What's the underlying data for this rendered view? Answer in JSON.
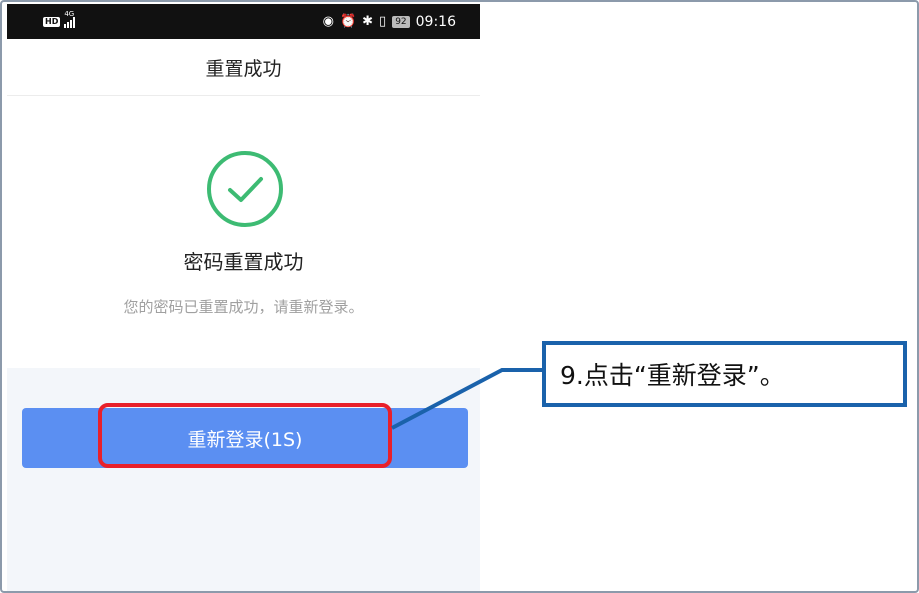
{
  "status_bar": {
    "hd_label": "HD",
    "network_label": "4G",
    "battery_level": "92",
    "time": "09:16",
    "icons": [
      "hd-icon",
      "signal-icon",
      "eye-icon",
      "alarm-icon",
      "bluetooth-icon",
      "vibrate-icon",
      "battery-icon"
    ]
  },
  "navbar": {
    "title": "重置成功"
  },
  "result": {
    "icon": "check-circle-icon",
    "title": "密码重置成功",
    "description": "您的密码已重置成功，请重新登录。"
  },
  "relogin_button": {
    "label": "重新登录(1S)"
  },
  "annotation": {
    "callout_text": "9.点击“重新登录”。"
  },
  "colors": {
    "success_green": "#3dbb73",
    "button_blue": "#5b8ff2",
    "highlight_red": "#e8202a",
    "callout_blue": "#1a62ab"
  }
}
